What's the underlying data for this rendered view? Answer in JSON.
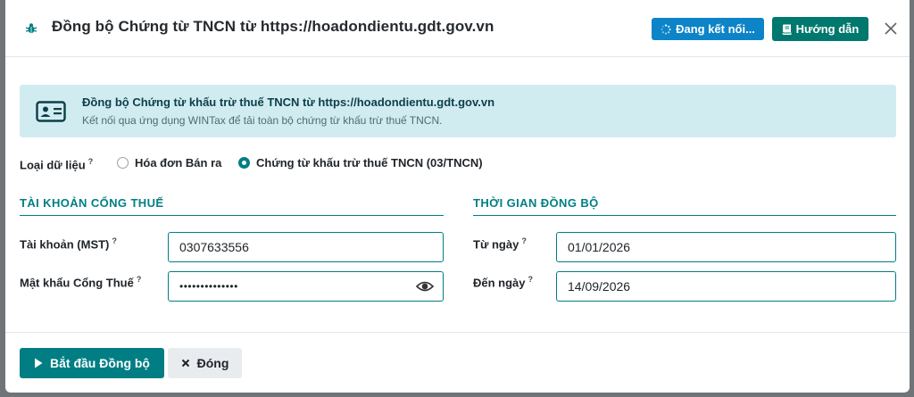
{
  "dialog": {
    "title": "Đồng bộ Chứng từ TNCN từ https://hoadondientu.gdt.gov.vn",
    "connect_label": "Đang kết nối...",
    "guide_label": "Hướng dẫn"
  },
  "banner": {
    "title": "Đồng bộ Chứng từ khấu trừ thuế TNCN từ https://hoadondientu.gdt.gov.vn",
    "subtitle": "Kết nối qua ứng dụng WINTax để tải toàn bộ chứng từ khấu trừ thuế TNCN."
  },
  "data_type": {
    "label": "Loại dữ liệu",
    "help": "?",
    "options": [
      {
        "label": "Hóa đơn Bán ra",
        "checked": false
      },
      {
        "label": "Chứng từ khấu trừ thuế TNCN (03/TNCN)",
        "checked": true
      }
    ]
  },
  "account": {
    "section_title": "TÀI KHOẢN CỔNG THUẾ",
    "mst_label": "Tài khoản (MST)",
    "mst_help": "?",
    "mst_value": "0307633556",
    "password_label": "Mật khẩu Cổng Thuế",
    "password_help": "?",
    "password_value": "••••••••••••••"
  },
  "sync_time": {
    "section_title": "THỜI GIAN ĐỒNG BỘ",
    "from_label": "Từ ngày",
    "from_help": "?",
    "from_value": "01/01/2026",
    "to_label": "Đến ngày",
    "to_help": "?",
    "to_value": "14/09/2026"
  },
  "footer": {
    "start_label": "Bắt đầu Đồng bộ",
    "close_label": "Đóng"
  },
  "colors": {
    "primary": "#017e84",
    "info": "#0d84c7",
    "guide": "#00786d",
    "banner_bg": "#d1ecf1"
  },
  "icons": [
    "bug-icon",
    "spinner-icon",
    "book-icon",
    "close-icon",
    "id-card-icon",
    "eye-icon",
    "play-icon",
    "x-icon"
  ]
}
